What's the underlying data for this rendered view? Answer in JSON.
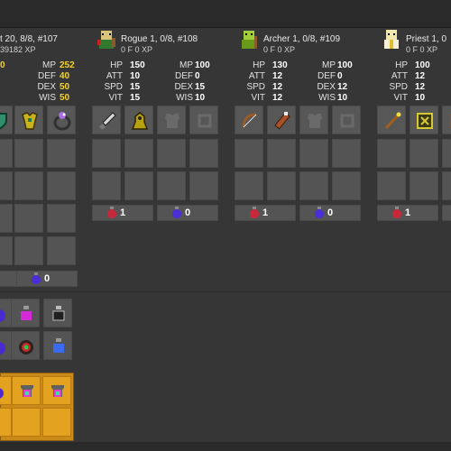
{
  "characters": [
    {
      "id": "knight",
      "title": "t 20, 8/8, #107",
      "subtitle": "39182 XP",
      "stats_right": [
        {
          "label": "MP",
          "value": "252",
          "gold": true
        },
        {
          "label": "DEF",
          "value": "40",
          "gold": true
        },
        {
          "label": "DEX",
          "value": "50",
          "gold": true
        },
        {
          "label": "WIS",
          "value": "50",
          "gold": true
        }
      ],
      "potions": {
        "red": "",
        "blue": "0"
      }
    },
    {
      "id": "rogue",
      "title": "Rogue 1, 0/8, #108",
      "subtitle": "0 F 0 XP",
      "stats_left": [
        {
          "label": "HP",
          "value": "150"
        },
        {
          "label": "ATT",
          "value": "10"
        },
        {
          "label": "SPD",
          "value": "15"
        },
        {
          "label": "VIT",
          "value": "15"
        }
      ],
      "stats_right": [
        {
          "label": "MP",
          "value": "100"
        },
        {
          "label": "DEF",
          "value": "0"
        },
        {
          "label": "DEX",
          "value": "15"
        },
        {
          "label": "WIS",
          "value": "10"
        }
      ],
      "potions": {
        "red": "1",
        "blue": "0"
      }
    },
    {
      "id": "archer",
      "title": "Archer 1, 0/8, #109",
      "subtitle": "0 F 0 XP",
      "stats_left": [
        {
          "label": "HP",
          "value": "130"
        },
        {
          "label": "ATT",
          "value": "12"
        },
        {
          "label": "SPD",
          "value": "12"
        },
        {
          "label": "VIT",
          "value": "12"
        }
      ],
      "stats_right": [
        {
          "label": "MP",
          "value": "100"
        },
        {
          "label": "DEF",
          "value": "0"
        },
        {
          "label": "DEX",
          "value": "12"
        },
        {
          "label": "WIS",
          "value": "10"
        }
      ],
      "potions": {
        "red": "1",
        "blue": "0"
      }
    },
    {
      "id": "priest",
      "title": "Priest 1, 0",
      "subtitle": "0 F 0 XP",
      "stats_left": [
        {
          "label": "HP",
          "value": "100"
        },
        {
          "label": "ATT",
          "value": "12"
        },
        {
          "label": "SPD",
          "value": "12"
        },
        {
          "label": "VIT",
          "value": "10"
        }
      ],
      "potions": {
        "red": "1",
        "blue": ""
      }
    }
  ],
  "colors": {
    "background": "#363636",
    "slot": "#545454",
    "gold_stat": "#f4d22a",
    "vault": "#c98a1a"
  }
}
